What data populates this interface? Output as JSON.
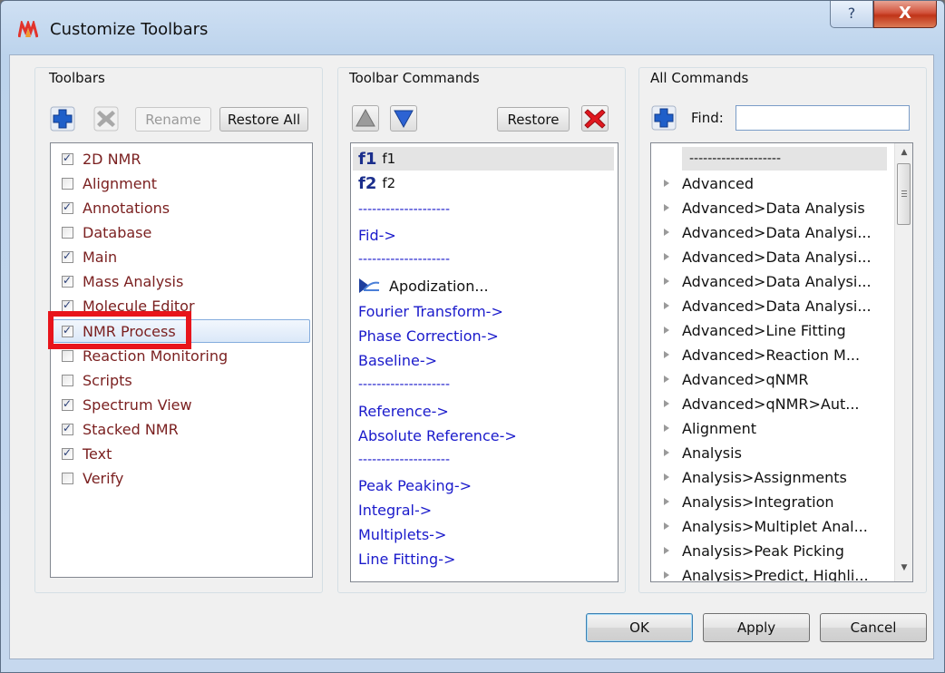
{
  "window": {
    "title": "Customize Toolbars",
    "help_glyph": "?",
    "close_glyph": "X"
  },
  "toolbars": {
    "group_label": "Toolbars",
    "rename_label": "Rename",
    "restore_all_label": "Restore All",
    "items": [
      {
        "label": "2D NMR",
        "checked": true
      },
      {
        "label": "Alignment",
        "checked": false
      },
      {
        "label": "Annotations",
        "checked": true
      },
      {
        "label": "Database",
        "checked": false
      },
      {
        "label": "Main",
        "checked": true
      },
      {
        "label": "Mass Analysis",
        "checked": true
      },
      {
        "label": "Molecule Editor",
        "checked": true
      },
      {
        "label": "NMR Process",
        "checked": true
      },
      {
        "label": "Reaction Monitoring",
        "checked": false
      },
      {
        "label": "Scripts",
        "checked": false
      },
      {
        "label": "Spectrum View",
        "checked": true
      },
      {
        "label": "Stacked NMR",
        "checked": true
      },
      {
        "label": "Text",
        "checked": true
      },
      {
        "label": "Verify",
        "checked": false
      }
    ]
  },
  "toolbar_commands": {
    "group_label": "Toolbar Commands",
    "restore_label": "Restore",
    "items": [
      {
        "icon_text": "f1",
        "label": "f1"
      },
      {
        "icon_text": "f2",
        "label": "f2"
      },
      {
        "label": "--------------------"
      },
      {
        "label": "Fid->"
      },
      {
        "label": "--------------------"
      },
      {
        "label": "Apodization..."
      },
      {
        "label": "Fourier Transform->"
      },
      {
        "label": "Phase Correction->"
      },
      {
        "label": "Baseline->"
      },
      {
        "label": "--------------------"
      },
      {
        "label": "Reference->"
      },
      {
        "label": "Absolute Reference->"
      },
      {
        "label": "--------------------"
      },
      {
        "label": "Peak Peaking->"
      },
      {
        "label": "Integral->"
      },
      {
        "label": "Multiplets->"
      },
      {
        "label": "Line Fitting->"
      }
    ]
  },
  "all_commands": {
    "group_label": "All Commands",
    "find_label": "Find:",
    "find_value": "",
    "items": [
      "--------------------",
      "Advanced",
      "Advanced>Data Analysis",
      "Advanced>Data Analysi...",
      "Advanced>Data Analysi...",
      "Advanced>Data Analysi...",
      "Advanced>Data Analysi...",
      "Advanced>Line Fitting",
      "Advanced>Reaction M...",
      "Advanced>qNMR",
      "Advanced>qNMR>Aut...",
      "Alignment",
      "Analysis",
      "Analysis>Assignments",
      "Analysis>Integration",
      "Analysis>Multiplet Anal...",
      "Analysis>Peak Picking",
      "Analysis>Predict, Highli..."
    ]
  },
  "buttons": {
    "ok": "OK",
    "apply": "Apply",
    "cancel": "Cancel"
  },
  "colors": {
    "highlight_box": "#e8141b",
    "command_blue": "#1a1acb",
    "toolbar_label": "#7a1f1f"
  }
}
